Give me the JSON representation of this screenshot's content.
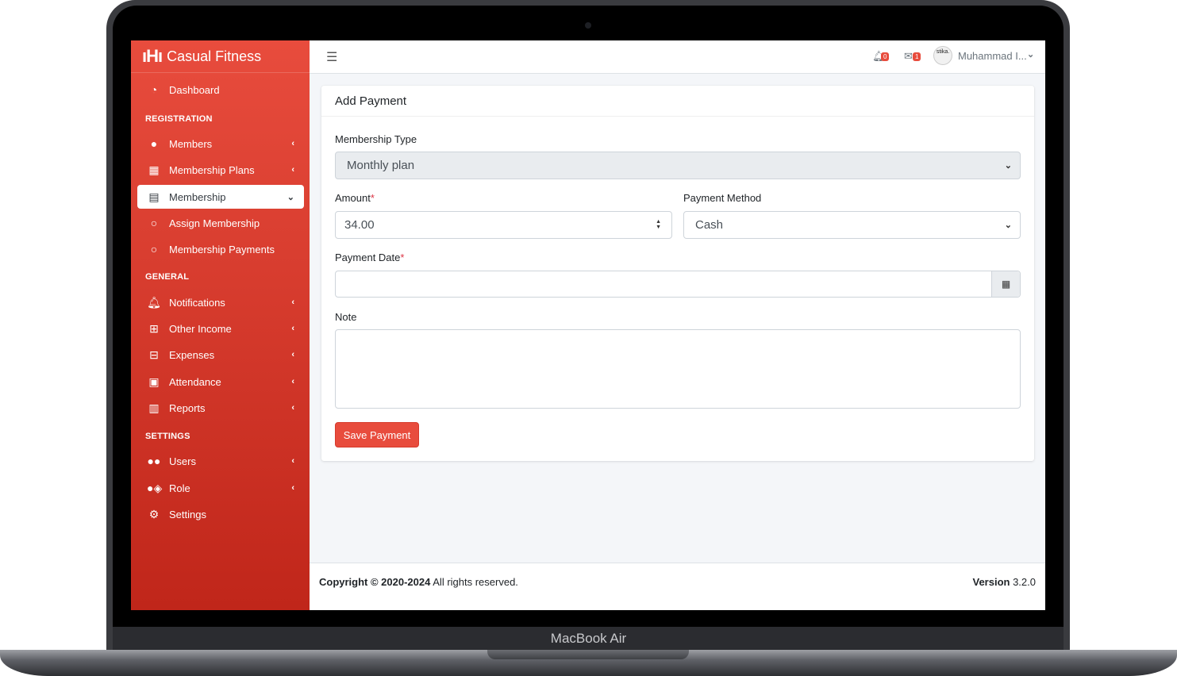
{
  "device": {
    "label": "MacBook Air"
  },
  "app": {
    "name": "Casual Fitness",
    "logo": "barbell-logo"
  },
  "sidebar": {
    "dashboard": {
      "label": "Dashboard",
      "icon": "tachometer-icon"
    },
    "sections": [
      {
        "header": "REGISTRATION"
      },
      {
        "header": "GENERAL"
      },
      {
        "header": "SETTINGS"
      }
    ],
    "items": {
      "members": {
        "label": "Members",
        "icon": "user-icon"
      },
      "membership_plans": {
        "label": "Membership Plans",
        "icon": "calendar-icon"
      },
      "membership": {
        "label": "Membership",
        "icon": "file-icon"
      },
      "assign_membership": {
        "label": "Assign Membership",
        "icon": "circle-icon"
      },
      "membership_payments": {
        "label": "Membership Payments",
        "icon": "circle-icon"
      },
      "notifications": {
        "label": "Notifications",
        "icon": "bell-icon"
      },
      "other_income": {
        "label": "Other Income",
        "icon": "plus-square-icon"
      },
      "expenses": {
        "label": "Expenses",
        "icon": "minus-square-icon"
      },
      "attendance": {
        "label": "Attendance",
        "icon": "address-book-icon"
      },
      "reports": {
        "label": "Reports",
        "icon": "bar-chart-icon"
      },
      "users": {
        "label": "Users",
        "icon": "users-icon"
      },
      "role": {
        "label": "Role",
        "icon": "user-shield-icon"
      },
      "settings": {
        "label": "Settings",
        "icon": "gears-icon"
      }
    }
  },
  "topbar": {
    "notifications_count": "0",
    "messages_count": "1",
    "user_name": "Muhammad I...",
    "avatar_text": "stika."
  },
  "form": {
    "title": "Add Payment",
    "membership_type": {
      "label": "Membership Type",
      "value": "Monthly plan"
    },
    "amount": {
      "label": "Amount",
      "required_mark": "*",
      "value": "34.00"
    },
    "payment_method": {
      "label": "Payment Method",
      "value": "Cash"
    },
    "payment_date": {
      "label": "Payment Date",
      "required_mark": "*",
      "value": ""
    },
    "note": {
      "label": "Note",
      "value": ""
    },
    "save_label": "Save Payment"
  },
  "footer": {
    "copyright_bold": "Copyright © 2020-2024",
    "copyright_rest": "All rights reserved.",
    "version_label": "Version",
    "version_value": "3.2.0"
  },
  "colors": {
    "accent": "#e84c3d",
    "accent_dark": "#c0261a",
    "background": "#f4f6f9"
  }
}
